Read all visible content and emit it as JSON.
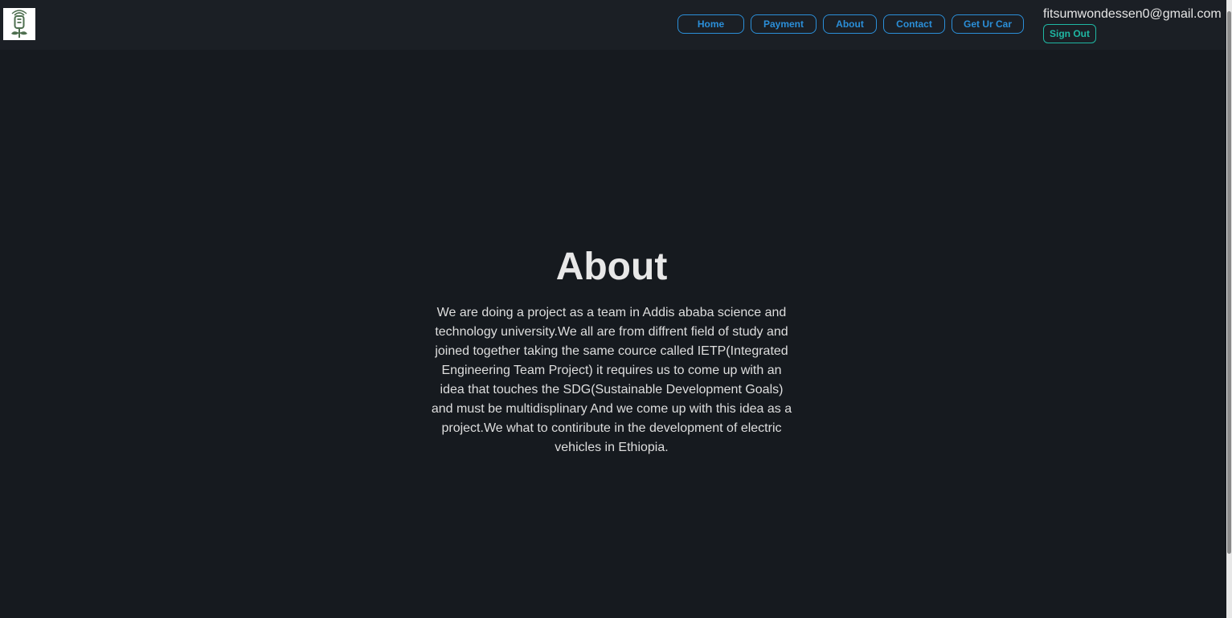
{
  "header": {
    "logo_icon": "ev-charger-plant-icon",
    "nav": [
      {
        "label": "Home"
      },
      {
        "label": "Payment"
      },
      {
        "label": "About"
      },
      {
        "label": "Contact"
      },
      {
        "label": "Get Ur Car"
      }
    ],
    "user_email": "fitsumwondessen0@gmail.com",
    "sign_out_label": "Sign Out"
  },
  "main": {
    "title": "About",
    "body": "We are doing a project as a team in Addis ababa science and technology university.We all are from diffrent field of study and joined together taking the same cource called IETP(Integrated Engineering Team Project) it requires us to come up with an idea that touches the SDG(Sustainable Development Goals) and must be multidisplinary And we come up with this idea as a project.We what to contiribute in the development of electric vehicles in Ethiopia."
  },
  "colors": {
    "background": "#161a1f",
    "header_background": "#1b1f25",
    "nav_accent": "#2b8fd9",
    "sign_out_accent": "#1fb7a3"
  }
}
